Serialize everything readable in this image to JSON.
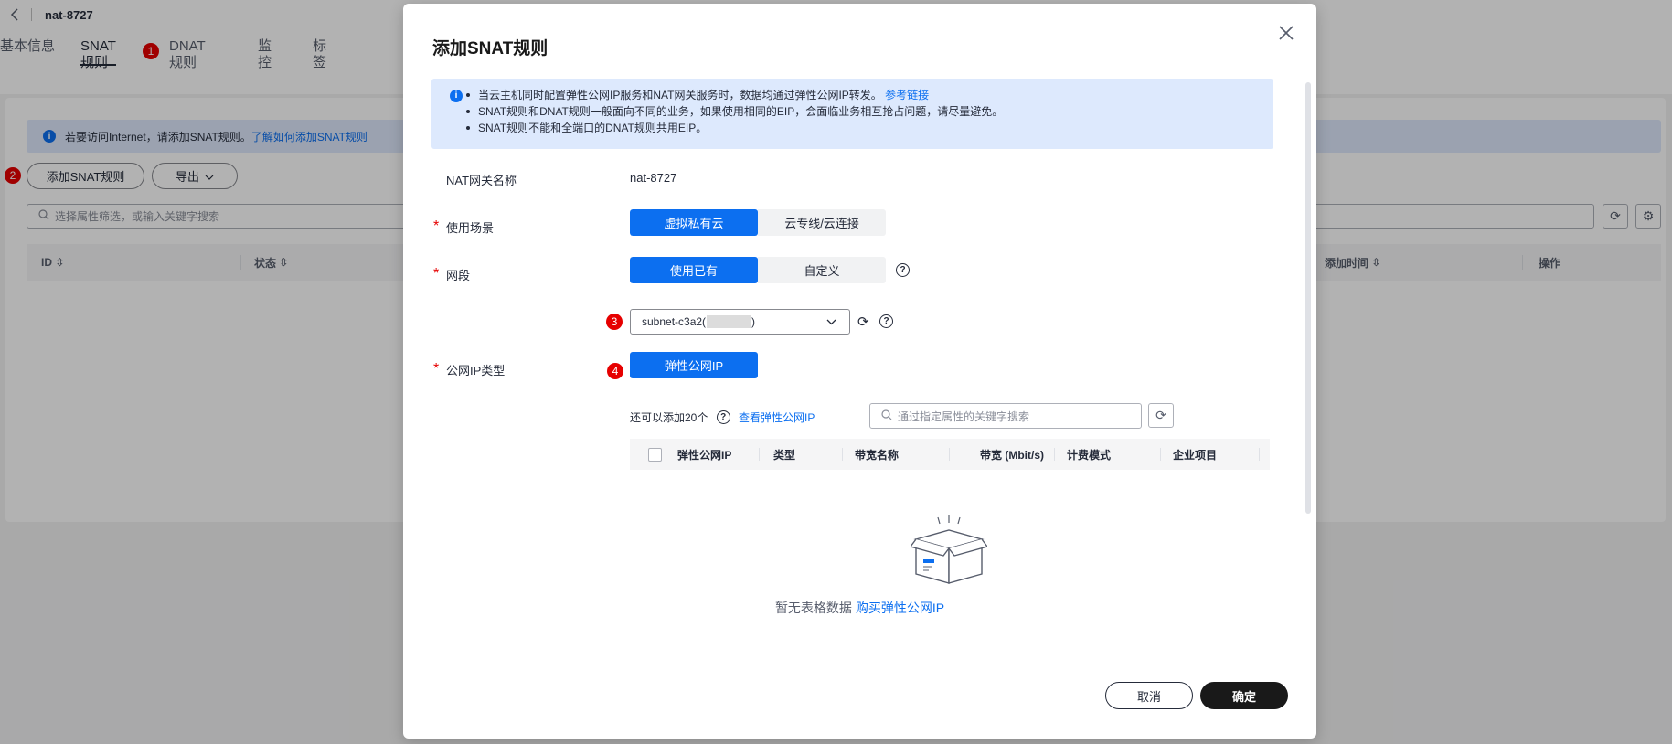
{
  "header": {
    "back_icon": "chevron-left-icon",
    "title": "nat-8727"
  },
  "tabs": [
    {
      "label": "基本信息",
      "active": false
    },
    {
      "label": "SNAT规则",
      "active": true
    },
    {
      "label": "DNAT规则",
      "active": false
    },
    {
      "label": "监控",
      "active": false
    },
    {
      "label": "标签",
      "active": false
    }
  ],
  "page_info": {
    "text": "若要访问Internet，请添加SNAT规则。",
    "link": "了解如何添加SNAT规则"
  },
  "toolbar": {
    "add_label": "添加SNAT规则",
    "export_label": "导出"
  },
  "search": {
    "placeholder": "选择属性筛选，或输入关键字搜索"
  },
  "table": {
    "columns": [
      "ID",
      "状态",
      "添加时间",
      "操作"
    ]
  },
  "badges": [
    "1",
    "2",
    "3",
    "4"
  ],
  "modal": {
    "title": "添加SNAT规则",
    "notice": {
      "line1_text": "当云主机同时配置弹性公网IP服务和NAT网关服务时，数据均通过弹性公网IP转发。",
      "line1_link": "参考链接",
      "line2": "SNAT规则和DNAT规则一般面向不同的业务，如果使用相同的EIP，会面临业务相互抢占问题，请尽量避免。",
      "line3": "SNAT规则不能和全端口的DNAT规则共用EIP。"
    },
    "gateway": {
      "label": "NAT网关名称",
      "value": "nat-8727"
    },
    "scenario": {
      "label": "使用场景",
      "options": [
        "虚拟私有云",
        "云专线/云连接"
      ],
      "selected": "虚拟私有云"
    },
    "subnet": {
      "label": "网段",
      "options": [
        "使用已有",
        "自定义"
      ],
      "selected": "使用已有"
    },
    "subnet_select": {
      "prefix": "subnet-c3a2(",
      "suffix": ")"
    },
    "ip_type": {
      "label": "公网IP类型",
      "option": "弹性公网IP"
    },
    "eip": {
      "counter": "还可以添加20个",
      "view_link": "查看弹性公网IP",
      "search_placeholder": "通过指定属性的关键字搜索",
      "columns": [
        "弹性公网IP",
        "类型",
        "带宽名称",
        "带宽 (Mbit/s)",
        "计费模式",
        "企业项目"
      ],
      "empty_text": "暂无表格数据",
      "empty_link": "购买弹性公网IP"
    },
    "cancel_label": "取消",
    "ok_label": "确定"
  },
  "colors": {
    "primary": "#0c6ff0",
    "badge": "#e60000",
    "info_bg": "#dee9fc"
  }
}
